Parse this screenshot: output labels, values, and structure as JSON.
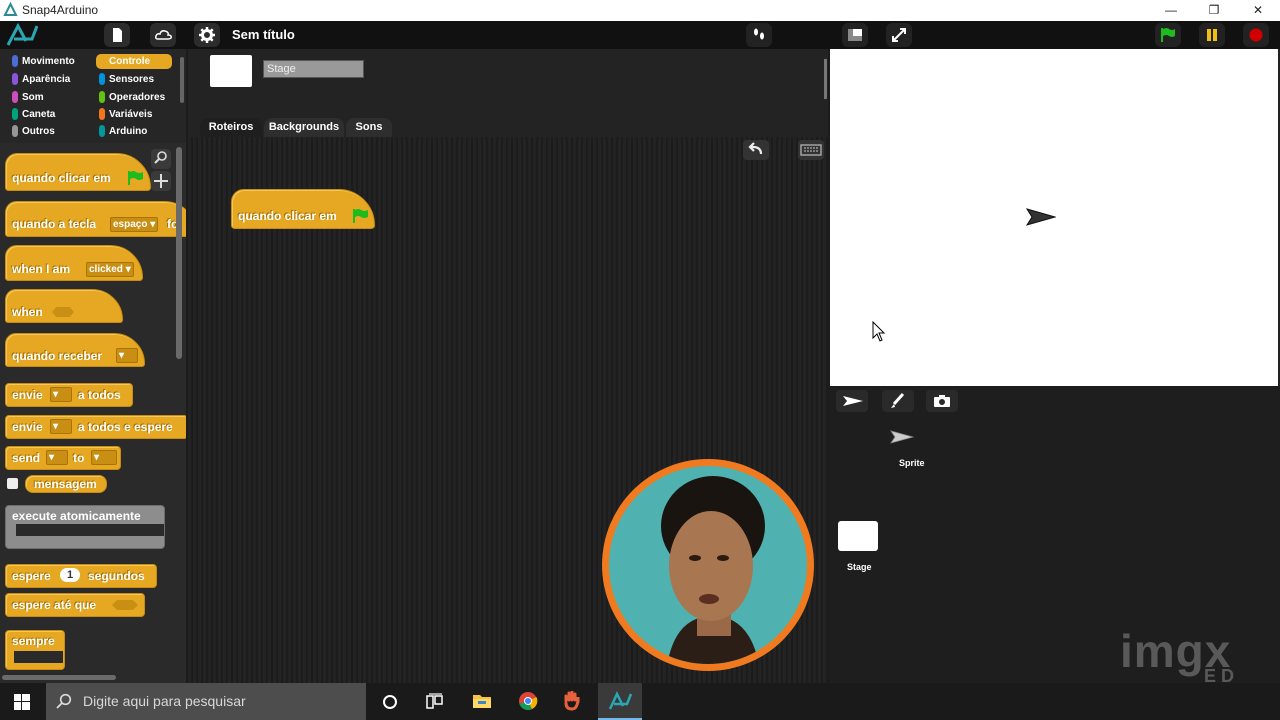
{
  "window": {
    "title": "Snap4Arduino",
    "controls": {
      "minimize": "—",
      "maximize": "❐",
      "close": "✕"
    }
  },
  "toolbar": {
    "project_title": "Sem título",
    "icons": [
      "file-icon",
      "cloud-icon",
      "gear-icon",
      "footprints-icon",
      "stage-size-icon",
      "fullscreen-icon",
      "green-flag-icon",
      "pause-icon",
      "stop-icon"
    ]
  },
  "categories": [
    {
      "label": "Movimento",
      "color": "#4a6cd4"
    },
    {
      "label": "Controle",
      "color": "#e6a822",
      "selected": true
    },
    {
      "label": "Aparência",
      "color": "#8a55d7"
    },
    {
      "label": "Sensores",
      "color": "#0094dd"
    },
    {
      "label": "Som",
      "color": "#c94fbb"
    },
    {
      "label": "Operadores",
      "color": "#62c213"
    },
    {
      "label": "Caneta",
      "color": "#00a27d"
    },
    {
      "label": "Variáveis",
      "color": "#f3761d"
    },
    {
      "label": "Outros",
      "color": "#969696"
    },
    {
      "label": "Arduino",
      "color": "#00979d"
    }
  ],
  "palette": {
    "blocks": {
      "when_flag": "quando clicar em",
      "when_key": "quando a tecla",
      "key_value": "espaço",
      "key_suffix": "fo",
      "when_i_am": "when I am",
      "when_i_am_value": "clicked",
      "when": "when",
      "receive": "quando receber",
      "broadcast": "envie",
      "broadcast_suffix": "a todos",
      "broadcast_wait_suffix": "a todos e espere",
      "send": "send",
      "send_to": "to",
      "message": "mensagem",
      "atomic": "execute atomicamente",
      "wait": "espere",
      "wait_value": "1",
      "wait_unit": "segundos",
      "wait_until": "espere até que",
      "forever": "sempre"
    }
  },
  "sprite_bar": {
    "name_value": "Stage",
    "tabs": [
      "Roteiros",
      "Backgrounds",
      "Sons"
    ]
  },
  "scripts": {
    "script_block": "quando clicar em"
  },
  "corral": {
    "sprite_label": "Sprite",
    "stage_label": "Stage"
  },
  "taskbar": {
    "search_placeholder": "Digite aqui para pesquisar"
  },
  "watermark": {
    "line1": "imgx",
    "line2": "ED"
  }
}
